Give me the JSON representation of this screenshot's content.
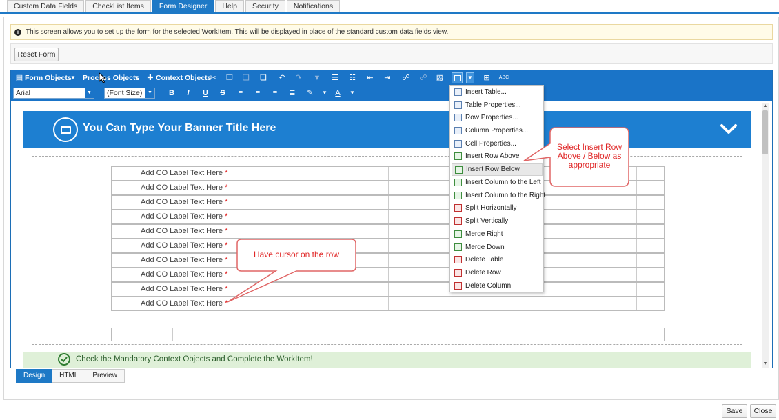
{
  "top_tabs": [
    {
      "label": "Custom Data Fields",
      "active": false
    },
    {
      "label": "CheckList Items",
      "active": false
    },
    {
      "label": "Form Designer",
      "active": true
    },
    {
      "label": "Help",
      "active": false
    },
    {
      "label": "Security",
      "active": false
    },
    {
      "label": "Notifications",
      "active": false
    }
  ],
  "info": {
    "icon": "info-icon",
    "text": "This screen allows you to set up the form for the selected WorkItem. This will be displayed in place of the standard custom data fields view."
  },
  "actions": {
    "reset_label": "Reset Form"
  },
  "toolbar": {
    "form_objects": "Form Objects",
    "process_objects": "Process Objects",
    "context_objects": "Context Objects",
    "font_name": "Arial",
    "font_size": "(Font Size)",
    "bold": "B",
    "italic": "I",
    "underline": "U",
    "strike": "S",
    "spell": "ABC"
  },
  "banner": {
    "title": "You Can Type Your Banner Title Here"
  },
  "form": {
    "row_label": "Add CO Label Text Here",
    "required_mark": "*",
    "rows": 10
  },
  "footer": {
    "message": "Check the Mandatory Context Objects and Complete the WorkItem!"
  },
  "mode_tabs": [
    {
      "label": "Design",
      "active": true
    },
    {
      "label": "HTML",
      "active": false
    },
    {
      "label": "Preview",
      "active": false
    }
  ],
  "table_menu": {
    "items": [
      {
        "label": "Insert Table...",
        "icon": "table-icon"
      },
      {
        "label": "Table Properties...",
        "icon": "table-properties-icon"
      },
      {
        "label": "Row Properties...",
        "icon": "row-properties-icon"
      },
      {
        "label": "Column Properties...",
        "icon": "column-properties-icon"
      },
      {
        "label": "Cell Properties...",
        "icon": "cell-properties-icon"
      },
      {
        "label": "Insert Row Above",
        "icon": "insert-row-above-icon"
      },
      {
        "label": "Insert Row Below",
        "icon": "insert-row-below-icon"
      },
      {
        "label": "Insert Column to the Left",
        "icon": "insert-column-left-icon"
      },
      {
        "label": "Insert Column to the Right",
        "icon": "insert-column-right-icon"
      },
      {
        "label": "Split Horizontally",
        "icon": "split-horizontal-icon"
      },
      {
        "label": "Split Vertically",
        "icon": "split-vertical-icon"
      },
      {
        "label": "Merge Right",
        "icon": "merge-right-icon"
      },
      {
        "label": "Merge Down",
        "icon": "merge-down-icon"
      },
      {
        "label": "Delete Table",
        "icon": "delete-table-icon"
      },
      {
        "label": "Delete Row",
        "icon": "delete-row-icon"
      },
      {
        "label": "Delete Column",
        "icon": "delete-column-icon"
      }
    ],
    "hovered": "Insert Row Below"
  },
  "callouts": {
    "cursor_note": "Have cursor on the row",
    "menu_note_1": "Select Insert Row",
    "menu_note_2": "Above / Below as",
    "menu_note_3": "appropriate"
  },
  "dialog_buttons": {
    "save": "Save",
    "close": "Close"
  },
  "colors": {
    "accent": "#1e79c6",
    "toolbar": "#1a74c8",
    "callout": "#e02727",
    "success_band": "#dff0d8"
  }
}
